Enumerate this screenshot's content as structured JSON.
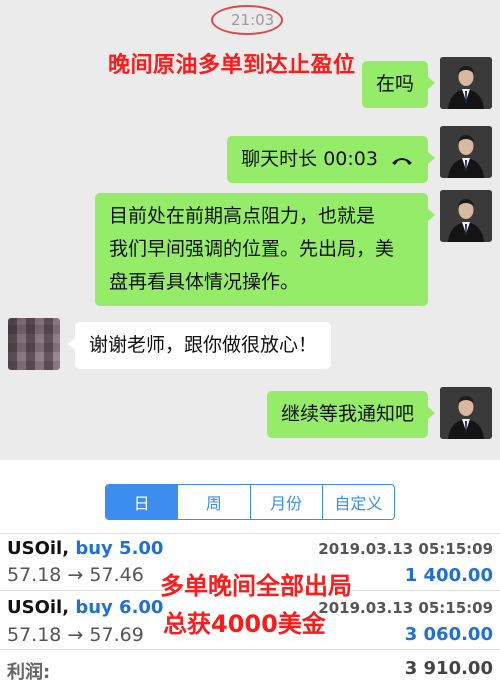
{
  "chat": {
    "timestamp": "21:03",
    "overlay_title": "晚间原油多单到达止盈位",
    "messages": [
      {
        "side": "right",
        "text": "在吗"
      },
      {
        "side": "right",
        "text": "聊天时长 00:03",
        "icon": "phone-icon"
      },
      {
        "side": "right",
        "lines": [
          "目前处在前期高点阻力，也就是",
          "我们早间强调的位置。先出局，美",
          "盘再看具体情况操作。"
        ]
      },
      {
        "side": "left",
        "text": "谢谢老师，跟你做很放心！"
      },
      {
        "side": "right",
        "text": "继续等我通知吧"
      }
    ]
  },
  "history": {
    "tabs": [
      {
        "label": "日",
        "active": true
      },
      {
        "label": "周",
        "active": false
      },
      {
        "label": "月份",
        "active": false
      },
      {
        "label": "自定义",
        "active": false
      }
    ],
    "trades": [
      {
        "symbol": "USOil,",
        "type": "buy 5.00",
        "datetime": "2019.03.13 05:15:09",
        "prices": "57.18 → 57.46",
        "profit": "1 400.00"
      },
      {
        "symbol": "USOil,",
        "type": "buy 6.00",
        "datetime": "2019.03.13 05:15:09",
        "prices": "57.18 → 57.69",
        "profit": "3 060.00"
      }
    ],
    "overlay_line1": "多单晚间全部出局",
    "overlay_line2": "总获4000美金",
    "total_label": "利润:",
    "total_value": "3 910.00",
    "accent_color": "#3b8df0"
  }
}
